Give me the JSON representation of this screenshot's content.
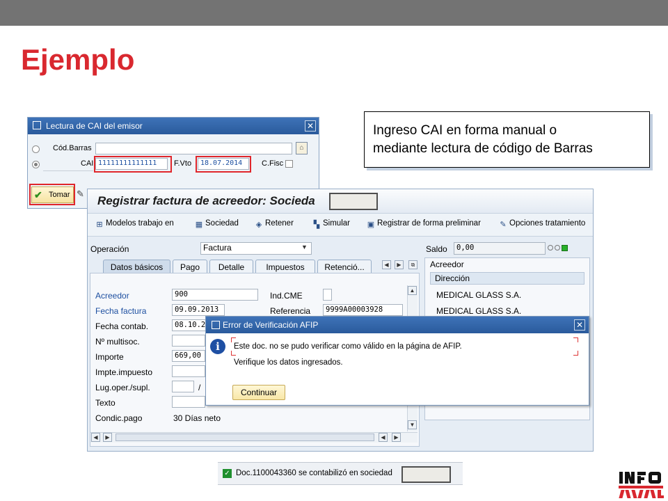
{
  "slide": {
    "title": "Ejemplo"
  },
  "cai_dialog": {
    "title": "Lectura de CAI del emisor",
    "close": "✕",
    "cod_barras_label": "Cód.Barras",
    "cai_label": "CAI",
    "cai_value": "11111111111111",
    "fvto_label": "F.Vto",
    "fvto_value": "18.07.2014",
    "cfisc_label": "C.Fisc",
    "tomar_label": "Tomar"
  },
  "callout": {
    "line1": "Ingreso CAI en forma manual o",
    "line2": "mediante lectura de código de Barras"
  },
  "main_window": {
    "title": "Registrar factura de acreedor: Socieda",
    "toolbar": [
      "Modelos trabajo en",
      "Sociedad",
      "Retener",
      "Simular",
      "Registrar de forma preliminar",
      "Opciones tratamiento"
    ],
    "operacion_label": "Operación",
    "operacion_value": "Factura",
    "saldo_label": "Saldo",
    "saldo_value": "0,00",
    "tabs": [
      "Datos básicos",
      "Pago",
      "Detalle",
      "Impuestos",
      "Retenció..."
    ],
    "fields": {
      "acreedor_label": "Acreedor",
      "acreedor_value": "900",
      "fecha_factura_label": "Fecha factura",
      "fecha_factura_value": "09.09.2013",
      "fecha_contab_label": "Fecha contab.",
      "fecha_contab_value": "08.10.2",
      "multisoc_label": "Nº multisoc.",
      "importe_label": "Importe",
      "importe_value": "669,00",
      "impte_impuesto_label": "Impte.impuesto",
      "lug_oper_label": "Lug.oper./supl.",
      "lug_oper_sep": "/",
      "texto_label": "Texto",
      "condic_pago_label": "Condic.pago",
      "condic_pago_value": "30 Días neto",
      "ind_cme_label": "Ind.CME",
      "referencia_label": "Referencia",
      "referencia_value": "9999A00003928"
    },
    "acreedor_panel": {
      "header": "Acreedor",
      "direccion_label": "Dirección",
      "line1": "MEDICAL GLASS S.A.",
      "line2": "MEDICAL GLASS S.A."
    }
  },
  "error_dialog": {
    "title": "Error de Verificación AFIP",
    "close": "✕",
    "message1": "Este doc. no se pudo verificar como válido en la página de AFIP.",
    "message2": "Verifique los datos ingresados.",
    "button": "Continuar"
  },
  "status_bar": {
    "message": "Doc.1100043360 se contabilizó en sociedad"
  },
  "colors": {
    "accent": "#d9282f",
    "sap_blue": "#2a5a9c",
    "status_green": "#1f8f2e"
  }
}
